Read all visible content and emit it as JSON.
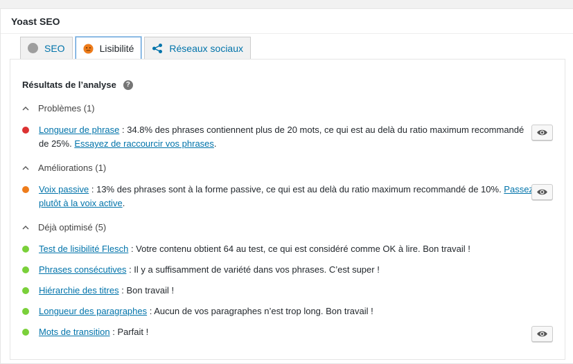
{
  "metabox": {
    "title": "Yoast SEO"
  },
  "tabs": [
    {
      "label": "SEO"
    },
    {
      "label": "Lisibilité"
    },
    {
      "label": "Réseaux sociaux"
    }
  ],
  "analysis": {
    "title": "Résultats de l’analyse",
    "help_icon_text": "?",
    "colors": {
      "red": "#dc3232",
      "orange": "#ee7c1b",
      "green": "#7ad03a",
      "link": "#0073aa"
    },
    "sections": [
      {
        "heading": "Problèmes (1)",
        "items": [
          {
            "link": "Longueur de phrase",
            "text": " : 34.8% des phrases contiennent plus de 20 mots, ce qui est au delà du ratio maximum recommandé de 25%. ",
            "link2": "Essayez de raccourcir vos phrases",
            "tail": ".",
            "status": "red"
          }
        ]
      },
      {
        "heading": "Améliorations (1)",
        "items": [
          {
            "link": "Voix passive",
            "text": " : 13% des phrases sont à la forme passive, ce qui est au delà du ratio maximum recommandé de 10%. ",
            "link2": "Passez plutôt à la voix active",
            "tail": ".",
            "status": "orange"
          }
        ]
      },
      {
        "heading": "Déjà optimisé (5)",
        "items": [
          {
            "link": "Test de lisibilité Flesch",
            "text": " : Votre contenu obtient 64 au test, ce qui est considéré comme OK à lire. Bon travail !",
            "status": "green"
          },
          {
            "link": "Phrases consécutives",
            "text": " : Il y a suffisamment de variété dans vos phrases. C’est super !",
            "status": "green"
          },
          {
            "link": "Hiérarchie des titres",
            "text": " : Bon travail !",
            "status": "green"
          },
          {
            "link": "Longueur des paragraphes",
            "text": " : Aucun de vos paragraphes n’est trop long. Bon travail !",
            "status": "green"
          },
          {
            "link": "Mots de transition",
            "text": " : Parfait !",
            "status": "green"
          }
        ]
      }
    ]
  }
}
